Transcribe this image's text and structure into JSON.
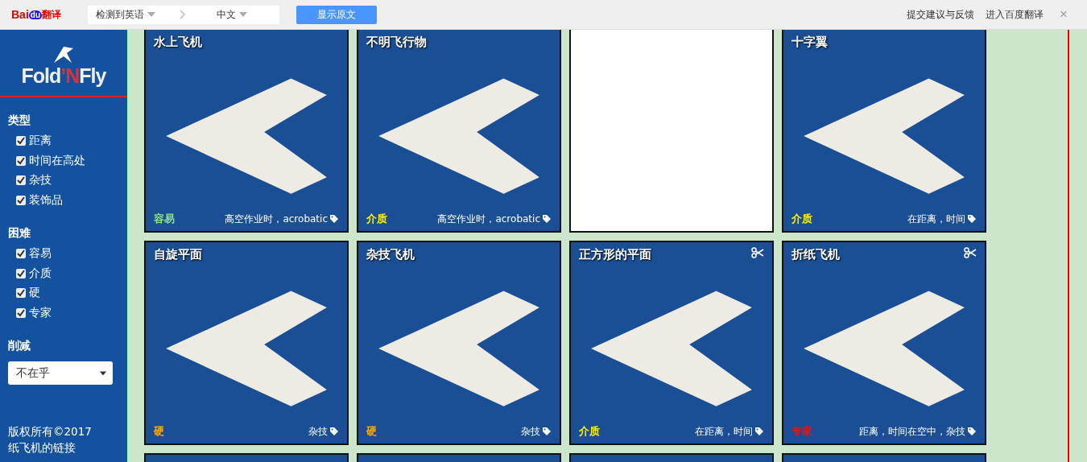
{
  "translate_bar": {
    "logo": {
      "part_1": "Bai",
      "part_2": "du",
      "part_3": "翻译"
    },
    "source_language": "检测到英语",
    "target_language": "中文",
    "show_original_button": "显示原文",
    "links": [
      "提交建议与反馈",
      "进入百度翻译"
    ],
    "close": "×"
  },
  "sidebar": {
    "logo": {
      "part_1": "Fold",
      "part_2": "’N",
      "part_3": "Fly"
    },
    "filter_groups": [
      {
        "title": "类型",
        "options": [
          {
            "label": "距离",
            "checked": true
          },
          {
            "label": "时间在高处",
            "checked": true
          },
          {
            "label": "杂技",
            "checked": true
          },
          {
            "label": "装饰品",
            "checked": true
          }
        ]
      },
      {
        "title": "困难",
        "options": [
          {
            "label": "容易",
            "checked": true
          },
          {
            "label": "介质",
            "checked": true
          },
          {
            "label": "硬",
            "checked": true
          },
          {
            "label": "专家",
            "checked": true
          }
        ]
      }
    ],
    "cutting": {
      "title": "削减",
      "value": "不在乎"
    },
    "footer": [
      "版权所有©2017",
      "纸飞机的链接"
    ]
  },
  "cards": [
    {
      "kind": "plane",
      "title": "水上飞机",
      "difficulty": "容易",
      "color": "#8ee08e",
      "tags": "高空作业时，acrobatic",
      "scissors": false
    },
    {
      "kind": "plane",
      "title": "不明飞行物",
      "difficulty": "介质",
      "color": "#ffee00",
      "tags": "高空作业时，acrobatic",
      "scissors": false
    },
    {
      "kind": "blank"
    },
    {
      "kind": "plane",
      "title": "十字翼",
      "difficulty": "介质",
      "color": "#ffee00",
      "tags": "在距离，时间",
      "scissors": false
    },
    {
      "kind": "plane",
      "title": "自旋平面",
      "difficulty": "硬",
      "color": "#ffaa00",
      "tags": "杂技",
      "scissors": false
    },
    {
      "kind": "plane",
      "title": "杂技飞机",
      "difficulty": "硬",
      "color": "#ffaa00",
      "tags": "杂技",
      "scissors": false
    },
    {
      "kind": "plane",
      "title": "正方形的平面",
      "difficulty": "介质",
      "color": "#ffee00",
      "tags": "在距离，时间",
      "scissors": true
    },
    {
      "kind": "plane",
      "title": "折纸飞机",
      "difficulty": "专家",
      "color": "#ee1111",
      "tags": "距离，时间在空中，杂技",
      "scissors": true
    },
    {
      "kind": "partial"
    },
    {
      "kind": "partial"
    },
    {
      "kind": "partial"
    },
    {
      "kind": "partial"
    }
  ]
}
